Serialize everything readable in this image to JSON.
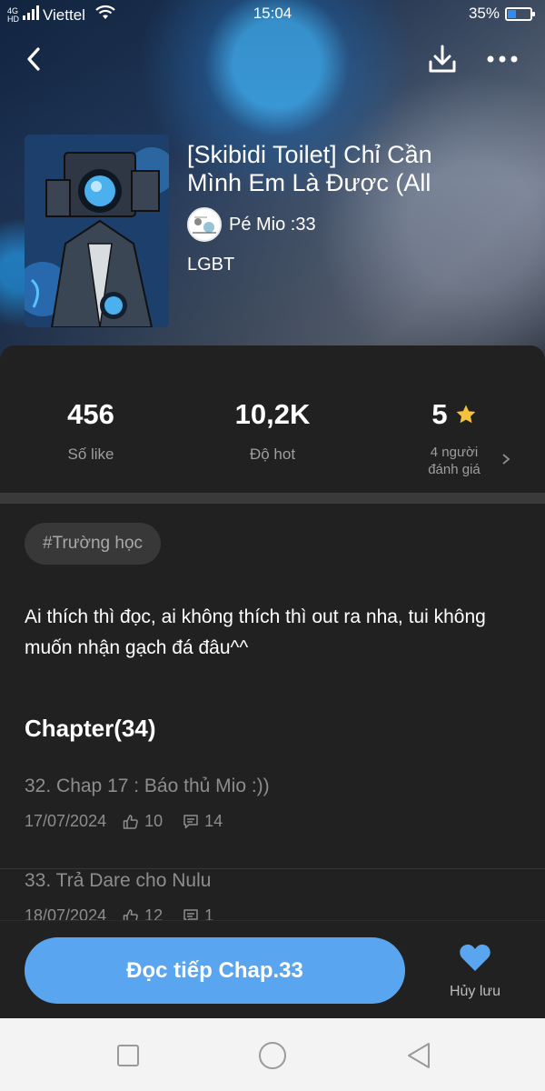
{
  "status_bar": {
    "network_tag_top": "4G",
    "network_tag_bottom": "HD",
    "carrier": "Viettel",
    "time": "15:04",
    "battery_text": "35%",
    "battery_level": 0.35
  },
  "story": {
    "title_line1": "[Skibidi Toilet] Chỉ Cần",
    "title_line2": "Mình Em Là Được (All",
    "author": "Pé Mio :33",
    "genre": "LGBT"
  },
  "stats": {
    "likes_value": "456",
    "likes_label": "Số like",
    "hot_value": "10,2K",
    "hot_label": "Độ hot",
    "rating_value": "5",
    "rating_label_line1": "4 người",
    "rating_label_line2": "đánh giá"
  },
  "tag": "#Trường học",
  "description": "Ai thích thì đọc, ai không thích thì out ra nha, tui không muốn nhận gạch đá đâu^^",
  "chapters": {
    "heading": "Chapter(34)",
    "items": [
      {
        "title": "32. Chap 17 : Báo thủ Mio :))",
        "date": "17/07/2024",
        "likes": "10",
        "comments": "14"
      },
      {
        "title": "33. Trả Dare cho Nulu",
        "date": "18/07/2024",
        "likes": "12",
        "comments": "1"
      }
    ]
  },
  "actions": {
    "read_button": "Đọc tiếp Chap.33",
    "unsave_label": "Hủy lưu"
  },
  "colors": {
    "accent_blue": "#5aa5f0",
    "star": "#f6c23e",
    "background": "#212121"
  },
  "icons": {
    "back": "chevron-left-icon",
    "download": "download-icon",
    "more": "more-dots-icon",
    "star": "star-icon",
    "like": "thumb-up-icon",
    "comment": "comment-icon",
    "heart": "heart-icon"
  }
}
